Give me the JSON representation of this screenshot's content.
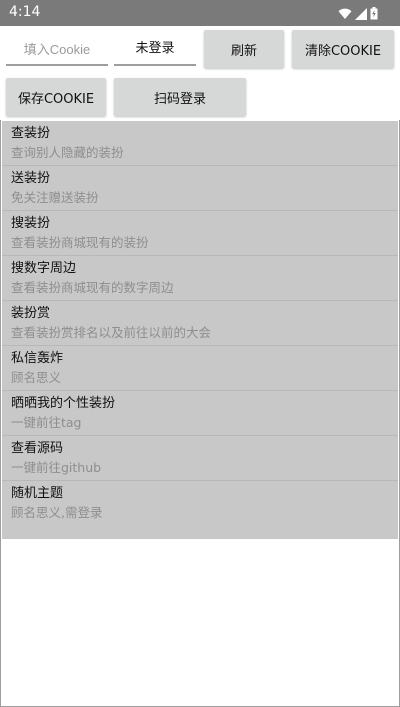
{
  "status_bar": {
    "time": "4:14",
    "icons": [
      "wifi-icon",
      "signal-icon",
      "battery-icon"
    ]
  },
  "top": {
    "cookie_placeholder": "填入Cookie",
    "login_status": "未登录",
    "refresh_label": "刷新",
    "clear_label": "清除COOKIE",
    "save_label": "保存COOKIE",
    "scan_label": "扫码登录"
  },
  "menu": {
    "items": [
      {
        "title": "查装扮",
        "subtitle": "查询别人隐藏的装扮"
      },
      {
        "title": "送装扮",
        "subtitle": "免关注赠送装扮"
      },
      {
        "title": "搜装扮",
        "subtitle": "查看装扮商城现有的装扮"
      },
      {
        "title": "搜数字周边",
        "subtitle": "查看装扮商城现有的数字周边"
      },
      {
        "title": "装扮赏",
        "subtitle": "查看装扮赏排名以及前往以前的大会"
      },
      {
        "title": "私信轰炸",
        "subtitle": "顾名思义"
      },
      {
        "title": "晒晒我的个性装扮",
        "subtitle": "一键前往tag"
      },
      {
        "title": "查看源码",
        "subtitle": "一键前往github"
      },
      {
        "title": "随机主题",
        "subtitle": "顾名思义,需登录"
      }
    ]
  },
  "colors": {
    "status_bar": "#7a7a7a",
    "button_bg": "#d6d7d7",
    "list_bg": "#c8c8c8",
    "subtitle": "#8e8e8e"
  }
}
